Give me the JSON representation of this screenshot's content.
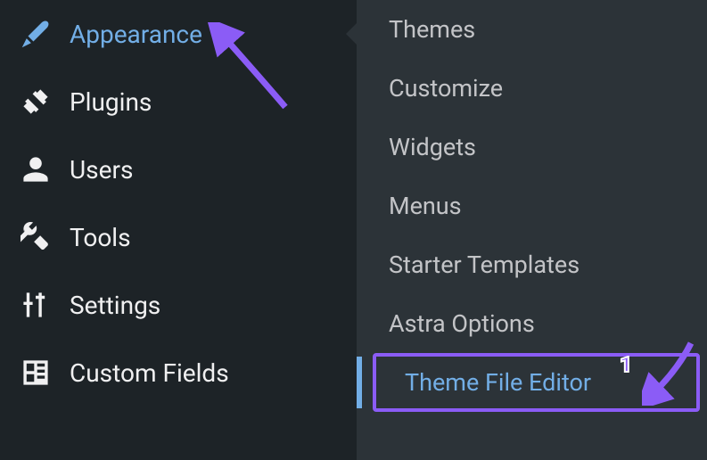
{
  "annotations": {
    "number": "1"
  },
  "mainMenu": {
    "items": [
      {
        "label": "Appearance",
        "icon": "paintbrush-icon",
        "active": true
      },
      {
        "label": "Plugins",
        "icon": "plug-icon"
      },
      {
        "label": "Users",
        "icon": "user-icon"
      },
      {
        "label": "Tools",
        "icon": "wrench-icon"
      },
      {
        "label": "Settings",
        "icon": "sliders-icon"
      },
      {
        "label": "Custom Fields",
        "icon": "layout-icon"
      }
    ]
  },
  "submenu": {
    "items": [
      {
        "label": "Themes"
      },
      {
        "label": "Customize"
      },
      {
        "label": "Widgets"
      },
      {
        "label": "Menus"
      },
      {
        "label": "Starter Templates"
      },
      {
        "label": "Astra Options"
      },
      {
        "label": "Theme File Editor",
        "highlighted": true
      }
    ]
  }
}
